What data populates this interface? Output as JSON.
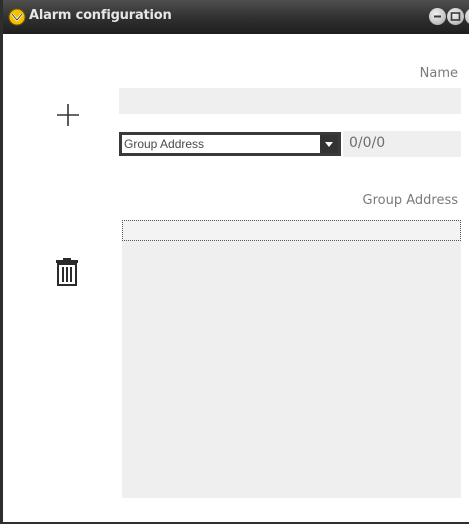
{
  "window": {
    "title": "Alarm configuration",
    "title_icon": "yellow-alarm-icon",
    "controls": [
      "minimize-icon",
      "maximize-icon",
      "close-icon"
    ]
  },
  "form": {
    "name_label": "Name",
    "name_value": "",
    "add_icon": "plus-icon",
    "type_select": {
      "selected": "Group Address"
    },
    "address_value": "0/0/0",
    "group_address_label": "Group Address",
    "delete_icon": "trash-icon",
    "group_address_list": [
      ""
    ]
  },
  "colors": {
    "titlebar": "#2f2f2f",
    "field_bg": "#efefef",
    "accent_yellow": "#f2c200"
  }
}
